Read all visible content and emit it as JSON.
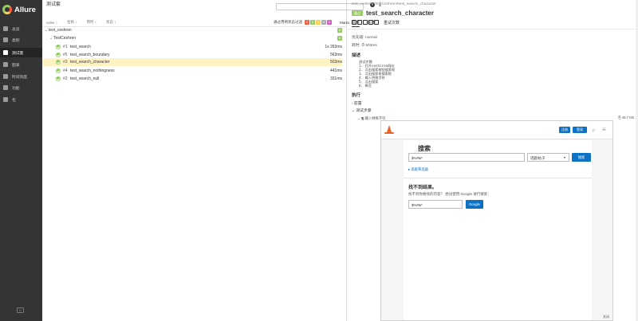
{
  "app": {
    "logo_text": "Allure"
  },
  "sidebar": {
    "items": [
      {
        "label": "总览",
        "icon": "home-icon"
      },
      {
        "label": "类别",
        "icon": "flag-icon"
      },
      {
        "label": "测试套",
        "icon": "briefcase-icon",
        "active": true
      },
      {
        "label": "图表",
        "icon": "chart-icon"
      },
      {
        "label": "时间刻度",
        "icon": "clock-icon"
      },
      {
        "label": "功能",
        "icon": "list-icon"
      },
      {
        "label": "包",
        "icon": "package-icon"
      }
    ],
    "collapse": "⊳"
  },
  "middle": {
    "title": "测试套",
    "status_label": "通过用例状态过滤",
    "status_counts": [
      "0",
      "5",
      "0",
      "0",
      "0"
    ],
    "status_colors": [
      "#fd5a3e",
      "#97cc64",
      "#ffd050",
      "#aaaaaa",
      "#d35ebe"
    ],
    "marks_label": "Marks",
    "columns": [
      "order ↕",
      "名称 ↕",
      "用时 ↕",
      "状态 ↕"
    ],
    "tree": {
      "root": {
        "name": "test_ceshren",
        "count": "5"
      },
      "suite": {
        "name": "TestCeshren",
        "count": "5"
      }
    },
    "cases": [
      {
        "idx": "#1",
        "name": "test_search",
        "dur": "1s 263ms"
      },
      {
        "idx": "#5",
        "name": "test_search_boundary",
        "dur": "563ms"
      },
      {
        "idx": "#3",
        "name": "test_search_character",
        "dur": "503ms",
        "selected": true
      },
      {
        "idx": "#4",
        "name": "test_search_nothingness",
        "dur": "441ms"
      },
      {
        "idx": "#2",
        "name": "test_search_null",
        "dur": "331ms"
      }
    ]
  },
  "detail": {
    "breadcrumb": "test_ceshren.TestCeshren#test_search_character",
    "status": "通过",
    "title": "test_search_character",
    "tabs": [
      "总览",
      "历史",
      "重试次数"
    ],
    "severity": "优先级: normal",
    "duration": "耗时: ⏱ 503ms",
    "desc_heading": "描述",
    "desc_lines": [
      "测试步骤",
      "1. 打开ceshiren网站",
      "2. 点击搜索按钮搜索框",
      "3. 点击搜索框搜索框",
      "4. 输入特殊字符",
      "5. 点击搜索",
      "6. 断言"
    ],
    "exec_heading": "执行",
    "exec_rows": [
      "› 前置",
      "⌄ 测试步骤"
    ],
    "step": "⌄ 🖫 输入特殊字符",
    "step_size": "⎘ 49.7 KB",
    "attachment": {
      "btn_register": "注册",
      "btn_login": "登录",
      "heading": "搜索",
      "query": "$%#&*",
      "select": "话题/帖子",
      "search_btn": "搜索",
      "advanced": "▸ 高级筛选器",
      "no_result": "找不到结果。",
      "hint": "找不到你要找的内容？ 尝试使用 Google 进行搜索：",
      "google_query": "$%#&*",
      "google_btn": "Google",
      "footer": "关闭"
    }
  }
}
